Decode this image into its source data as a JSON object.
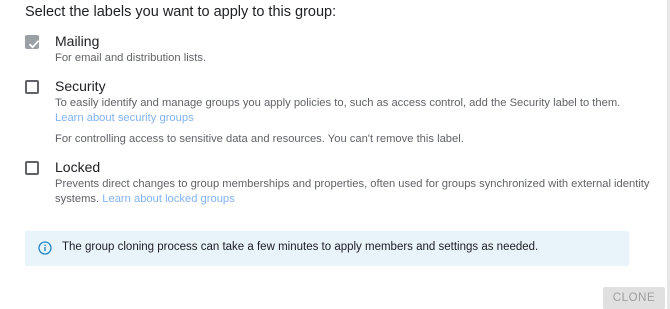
{
  "heading": "Select the labels you want to apply to this group:",
  "options": [
    {
      "title": "Mailing",
      "checked": true,
      "disabled": true,
      "desc1": "For email and distribution lists."
    },
    {
      "title": "Security",
      "checked": false,
      "desc1": "To easily identify and manage groups you apply policies to, such as access control, add the Security label to them.",
      "link": "Learn about security groups",
      "desc2": "For controlling access to sensitive data and resources. You can't remove this label."
    },
    {
      "title": "Locked",
      "checked": false,
      "desc1": "Prevents direct changes to group memberships and properties, often used for groups synchronized with external identity",
      "desc2": "systems.",
      "link": "Learn about locked groups"
    }
  ],
  "info": {
    "icon": "info-icon",
    "text": "The group cloning process can take a few minutes to apply members and settings as needed."
  },
  "actions": {
    "clone_label": "CLONE"
  },
  "colors": {
    "accent": "#1a73e8",
    "info_bg": "#e8f4fa",
    "info_icon": "#1e88c8"
  }
}
